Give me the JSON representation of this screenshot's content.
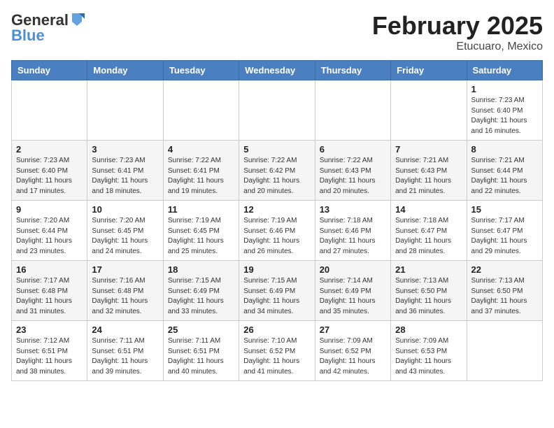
{
  "header": {
    "logo_general": "General",
    "logo_blue": "Blue",
    "month_title": "February 2025",
    "location": "Etucuaro, Mexico"
  },
  "days_of_week": [
    "Sunday",
    "Monday",
    "Tuesday",
    "Wednesday",
    "Thursday",
    "Friday",
    "Saturday"
  ],
  "weeks": [
    [
      {
        "day": "",
        "info": ""
      },
      {
        "day": "",
        "info": ""
      },
      {
        "day": "",
        "info": ""
      },
      {
        "day": "",
        "info": ""
      },
      {
        "day": "",
        "info": ""
      },
      {
        "day": "",
        "info": ""
      },
      {
        "day": "1",
        "info": "Sunrise: 7:23 AM\nSunset: 6:40 PM\nDaylight: 11 hours\nand 16 minutes."
      }
    ],
    [
      {
        "day": "2",
        "info": "Sunrise: 7:23 AM\nSunset: 6:40 PM\nDaylight: 11 hours\nand 17 minutes."
      },
      {
        "day": "3",
        "info": "Sunrise: 7:23 AM\nSunset: 6:41 PM\nDaylight: 11 hours\nand 18 minutes."
      },
      {
        "day": "4",
        "info": "Sunrise: 7:22 AM\nSunset: 6:41 PM\nDaylight: 11 hours\nand 19 minutes."
      },
      {
        "day": "5",
        "info": "Sunrise: 7:22 AM\nSunset: 6:42 PM\nDaylight: 11 hours\nand 20 minutes."
      },
      {
        "day": "6",
        "info": "Sunrise: 7:22 AM\nSunset: 6:43 PM\nDaylight: 11 hours\nand 20 minutes."
      },
      {
        "day": "7",
        "info": "Sunrise: 7:21 AM\nSunset: 6:43 PM\nDaylight: 11 hours\nand 21 minutes."
      },
      {
        "day": "8",
        "info": "Sunrise: 7:21 AM\nSunset: 6:44 PM\nDaylight: 11 hours\nand 22 minutes."
      }
    ],
    [
      {
        "day": "9",
        "info": "Sunrise: 7:20 AM\nSunset: 6:44 PM\nDaylight: 11 hours\nand 23 minutes."
      },
      {
        "day": "10",
        "info": "Sunrise: 7:20 AM\nSunset: 6:45 PM\nDaylight: 11 hours\nand 24 minutes."
      },
      {
        "day": "11",
        "info": "Sunrise: 7:19 AM\nSunset: 6:45 PM\nDaylight: 11 hours\nand 25 minutes."
      },
      {
        "day": "12",
        "info": "Sunrise: 7:19 AM\nSunset: 6:46 PM\nDaylight: 11 hours\nand 26 minutes."
      },
      {
        "day": "13",
        "info": "Sunrise: 7:18 AM\nSunset: 6:46 PM\nDaylight: 11 hours\nand 27 minutes."
      },
      {
        "day": "14",
        "info": "Sunrise: 7:18 AM\nSunset: 6:47 PM\nDaylight: 11 hours\nand 28 minutes."
      },
      {
        "day": "15",
        "info": "Sunrise: 7:17 AM\nSunset: 6:47 PM\nDaylight: 11 hours\nand 29 minutes."
      }
    ],
    [
      {
        "day": "16",
        "info": "Sunrise: 7:17 AM\nSunset: 6:48 PM\nDaylight: 11 hours\nand 31 minutes."
      },
      {
        "day": "17",
        "info": "Sunrise: 7:16 AM\nSunset: 6:48 PM\nDaylight: 11 hours\nand 32 minutes."
      },
      {
        "day": "18",
        "info": "Sunrise: 7:15 AM\nSunset: 6:49 PM\nDaylight: 11 hours\nand 33 minutes."
      },
      {
        "day": "19",
        "info": "Sunrise: 7:15 AM\nSunset: 6:49 PM\nDaylight: 11 hours\nand 34 minutes."
      },
      {
        "day": "20",
        "info": "Sunrise: 7:14 AM\nSunset: 6:49 PM\nDaylight: 11 hours\nand 35 minutes."
      },
      {
        "day": "21",
        "info": "Sunrise: 7:13 AM\nSunset: 6:50 PM\nDaylight: 11 hours\nand 36 minutes."
      },
      {
        "day": "22",
        "info": "Sunrise: 7:13 AM\nSunset: 6:50 PM\nDaylight: 11 hours\nand 37 minutes."
      }
    ],
    [
      {
        "day": "23",
        "info": "Sunrise: 7:12 AM\nSunset: 6:51 PM\nDaylight: 11 hours\nand 38 minutes."
      },
      {
        "day": "24",
        "info": "Sunrise: 7:11 AM\nSunset: 6:51 PM\nDaylight: 11 hours\nand 39 minutes."
      },
      {
        "day": "25",
        "info": "Sunrise: 7:11 AM\nSunset: 6:51 PM\nDaylight: 11 hours\nand 40 minutes."
      },
      {
        "day": "26",
        "info": "Sunrise: 7:10 AM\nSunset: 6:52 PM\nDaylight: 11 hours\nand 41 minutes."
      },
      {
        "day": "27",
        "info": "Sunrise: 7:09 AM\nSunset: 6:52 PM\nDaylight: 11 hours\nand 42 minutes."
      },
      {
        "day": "28",
        "info": "Sunrise: 7:09 AM\nSunset: 6:53 PM\nDaylight: 11 hours\nand 43 minutes."
      },
      {
        "day": "",
        "info": ""
      }
    ]
  ]
}
